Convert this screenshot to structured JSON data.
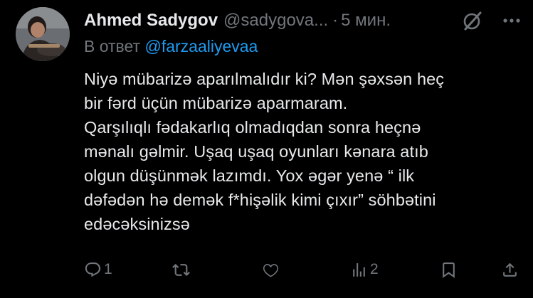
{
  "author": {
    "name": "Ahmed Sadygov",
    "handle": "@sadygova...",
    "separator": "·",
    "time": "5 мин."
  },
  "reply": {
    "prefix": "В ответ",
    "mention": "@farzaaliyevaa"
  },
  "tweet_text": "Niyə mübarizə aparılmalıdır ki? Mən şəxsən heç\nbir fərd üçün mübarizə aparmaram.\nQarşılıqlı fədakarlıq olmadıqdan sonra heçnə\nmənalı gəlmir. Uşaq uşaq oyunları kənara atıb\nolgun düşünmək lazımdı. Yox əgər yenə “ ilk\ndəfədən hə demək f*hişəlik kimi çıxır” söhbətini\nedəcəksinizsə",
  "actions": {
    "reply_count": "1",
    "retweet_count": "",
    "like_count": "",
    "views_count": "2"
  },
  "icons": {
    "grok": "grok-icon",
    "more": "more-icon",
    "reply": "reply-icon",
    "retweet": "retweet-icon",
    "like": "like-icon",
    "views": "views-icon",
    "bookmark": "bookmark-icon",
    "share": "share-icon"
  },
  "colors": {
    "background": "#000000",
    "text": "#e7e9ea",
    "secondary": "#71767b",
    "accent": "#1d9bf0"
  }
}
